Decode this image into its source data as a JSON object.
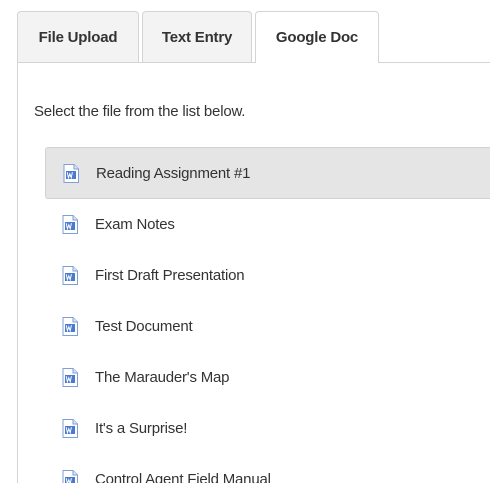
{
  "tabs": [
    {
      "label": "File Upload",
      "active": false
    },
    {
      "label": "Text Entry",
      "active": false
    },
    {
      "label": "Google Doc",
      "active": true
    }
  ],
  "instructions": "Select the file from the list below.",
  "files": [
    {
      "name": "Reading Assignment #1",
      "icon": "google-doc-icon",
      "selected": true
    },
    {
      "name": "Exam Notes",
      "icon": "google-doc-icon",
      "selected": false
    },
    {
      "name": "First Draft Presentation",
      "icon": "google-doc-icon",
      "selected": false
    },
    {
      "name": "Test Document",
      "icon": "google-doc-icon",
      "selected": false
    },
    {
      "name": "The Marauder's Map",
      "icon": "google-doc-icon",
      "selected": false
    },
    {
      "name": "It's a Surprise!",
      "icon": "google-doc-icon",
      "selected": false
    },
    {
      "name": "Control Agent Field Manual",
      "icon": "google-doc-icon",
      "selected": false
    }
  ],
  "colors": {
    "selected_row": "#e5e5e5",
    "icon_blue": "#4a7bd0",
    "border": "#d4d4d4"
  }
}
